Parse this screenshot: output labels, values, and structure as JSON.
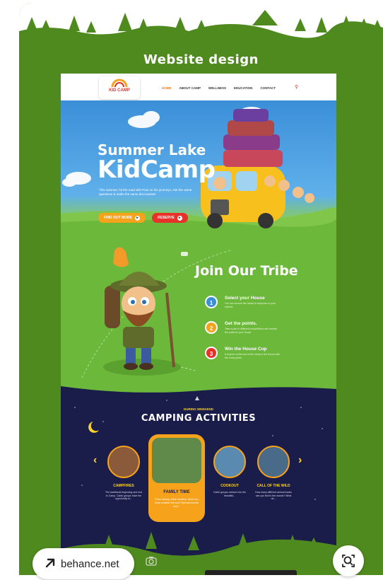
{
  "card": {
    "title": "Website design"
  },
  "nav": {
    "logo": "KID CAMP",
    "links": [
      "HOME",
      "ABOUT CAMP",
      "WELLNESS",
      "EDUCATION",
      "CONTACT"
    ],
    "active_link": "HOME",
    "search_icon": "search-icon"
  },
  "hero": {
    "title_line1": "Summer Lake",
    "title_line2": "KidCamp",
    "text": "This summer, hit the road with Paul on his journeys. Ask the same questions & make the same discoveries!",
    "find_label": "FIND OUT MORE",
    "reserve_label": "RESERVE"
  },
  "tribe": {
    "title": "Join Our Tribe",
    "steps": [
      {
        "num": "1",
        "title": "Select your House",
        "desc": "You can choose the house to depends on your interest",
        "color": "#3b8fd8"
      },
      {
        "num": "2",
        "title": "Get the points.",
        "desc": "Take a part in different competitions and receive the point for your House",
        "color": "#f6a21b"
      },
      {
        "num": "3",
        "title": "Win the House Cup",
        "desc": "It is given at the end of the camp to the house with the most points",
        "color": "#e8312a"
      }
    ]
  },
  "camp": {
    "pretitle": "DURING WEEKEND",
    "title": "CAMPING ACTIVITIES",
    "activities": [
      {
        "name": "CAMPFIRES",
        "desc": "The traditional beginning and end to Camp. Cabin groups have the opportunity to..."
      },
      {
        "name": "FAMILY TIME",
        "desc": "Think messy, think creative, think fun, think outside the box! Special events and..."
      },
      {
        "name": "COOKOUT",
        "desc": "Cabin groups venture into the beautiful..."
      },
      {
        "name": "CALL OF THE WILD",
        "desc": "How many different animal tracks can you find in the woods? What do..."
      }
    ]
  },
  "source": {
    "label": "behance.net"
  },
  "colors": {
    "green": "#4f8a1f",
    "navy": "#1a1d4a",
    "orange": "#f6a21b",
    "red": "#e8312a",
    "blue": "#3b8fd8"
  }
}
